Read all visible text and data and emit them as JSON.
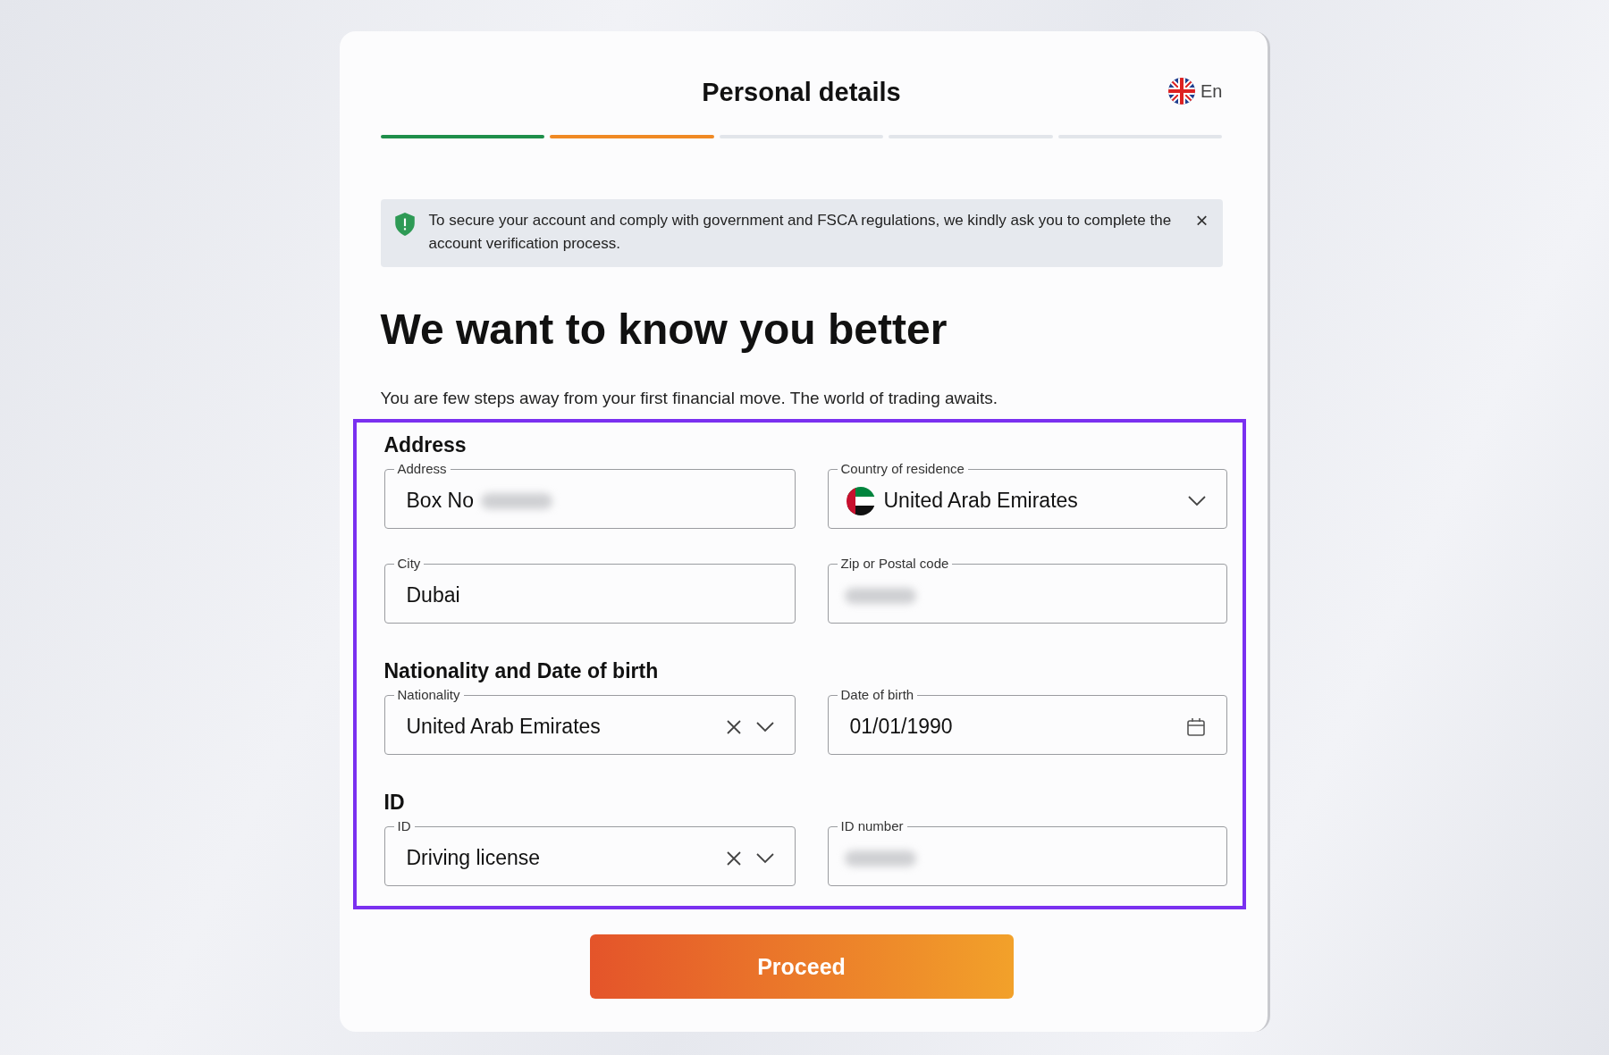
{
  "header": {
    "title": "Personal details",
    "language": "En"
  },
  "steps": [
    {
      "done": true,
      "current": false
    },
    {
      "done": false,
      "current": true
    },
    {
      "done": false,
      "current": false
    },
    {
      "done": false,
      "current": false
    },
    {
      "done": false,
      "current": false
    }
  ],
  "notice": {
    "text": "To secure your account and comply with government and FSCA regulations, we kindly ask you to complete the account verification process.",
    "close": "×"
  },
  "heading": "We want to know you better",
  "subtitle": "You are few steps away from your first financial move. The world of trading awaits.",
  "highlighted": true,
  "sections": [
    {
      "title": "Address",
      "fields": [
        {
          "kind": "text",
          "label": "Address",
          "value": "Box No",
          "blurred": true
        },
        {
          "kind": "select",
          "label": "Country of residence",
          "value": "United Arab Emirates",
          "flag": true,
          "clearable": false
        },
        {
          "kind": "text",
          "label": "City",
          "value": "Dubai",
          "blurred": false
        },
        {
          "kind": "text",
          "label": "Zip or Postal code",
          "blurred": true
        }
      ]
    },
    {
      "title": "Nationality and Date of birth",
      "fields": [
        {
          "kind": "select",
          "label": "Nationality",
          "value": "United Arab Emirates",
          "flag": false,
          "clearable": true
        },
        {
          "kind": "date",
          "label": "Date of birth",
          "value": "01/01/1990"
        }
      ]
    },
    {
      "title": "ID",
      "fields": [
        {
          "kind": "select",
          "label": "ID",
          "value": "Driving license",
          "flag": false,
          "clearable": true
        },
        {
          "kind": "text",
          "label": "ID number",
          "blurred": true
        }
      ]
    }
  ],
  "button": "Proceed"
}
